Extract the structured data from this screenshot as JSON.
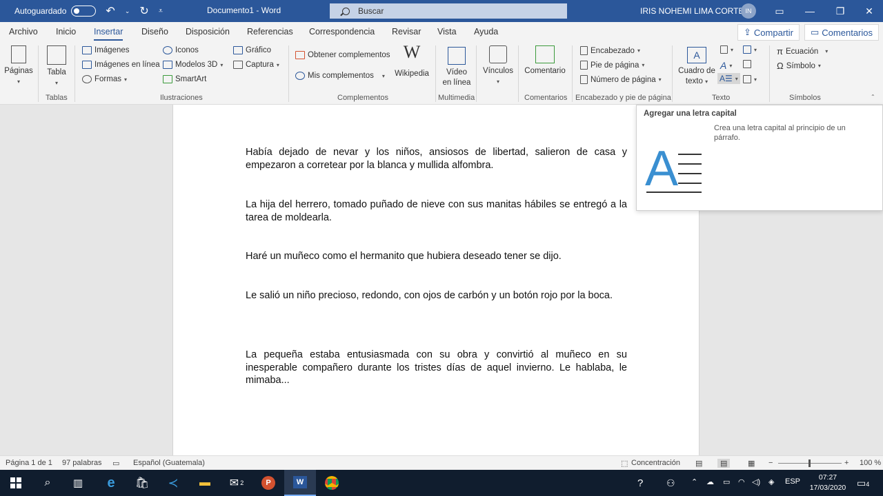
{
  "titlebar": {
    "autosave_label": "Autoguardado",
    "doc_title": "Documento1  -  Word",
    "search_placeholder": "Buscar",
    "user_name": "IRIS NOHEMI LIMA CORTEZ",
    "user_initials": "IN"
  },
  "tabs": [
    "Archivo",
    "Inicio",
    "Insertar",
    "Diseño",
    "Disposición",
    "Referencias",
    "Correspondencia",
    "Revisar",
    "Vista",
    "Ayuda"
  ],
  "actions": {
    "share": "Compartir",
    "comments": "Comentarios"
  },
  "ribbon": {
    "paginas": "Páginas",
    "tabla": "Tabla",
    "tablas_group": "Tablas",
    "imagenes": "Imágenes",
    "imagenes_linea": "Imágenes en línea",
    "formas": "Formas",
    "iconos": "Iconos",
    "modelos3d": "Modelos 3D",
    "smartart": "SmartArt",
    "grafico": "Gráfico",
    "captura": "Captura",
    "ilustraciones_group": "Ilustraciones",
    "obtener": "Obtener complementos",
    "mis": "Mis complementos",
    "wikipedia": "Wikipedia",
    "complementos_group": "Complementos",
    "video_line1": "Vídeo",
    "video_line2": "en línea",
    "multimedia_group": "Multimedia",
    "vinculos": "Vínculos",
    "comentario": "Comentario",
    "comentarios_group": "Comentarios",
    "encabezado": "Encabezado",
    "pie": "Pie de página",
    "numero": "Número de página",
    "encabezado_group": "Encabezado y pie de página",
    "cuadro_line1": "Cuadro de",
    "cuadro_line2": "texto",
    "texto_group": "Texto",
    "ecuacion": "Ecuación",
    "simbolo": "Símbolo",
    "simbolos_group": "Símbolos"
  },
  "document": {
    "paragraphs": [
      "Había dejado de nevar y los niños, ansiosos de libertad, salieron de casa y empezaron a corretear por la blanca y mullida alfombra.",
      "La hija del herrero, tomado puñado de nieve con sus manitas hábiles se entregó a la tarea de moldearla.",
      "Haré un muñeco como el hermanito que hubiera deseado tener se dijo.",
      "Le salió un niño precioso, redondo, con ojos de carbón y un botón rojo por la boca.",
      "La pequeña estaba entusiasmada con su obra y convirtió al muñeco en su inesperable compañero durante los tristes días de aquel invierno. Le hablaba, le mimaba..."
    ]
  },
  "tooltip": {
    "title": "Agregar una letra capital",
    "description": "Crea una letra capital al principio de un párrafo."
  },
  "statusbar": {
    "page": "Página 1 de 1",
    "words": "97 palabras",
    "language": "Español (Guatemala)",
    "focus": "Concentración",
    "zoom": "100 %"
  },
  "taskbar": {
    "time": "07:27",
    "date": "17/03/2020",
    "lang": "ESP",
    "mail_badge": "2",
    "notif_badge": "4"
  },
  "colors": {
    "accent": "#2b579a",
    "taskbar": "#101d2e"
  }
}
